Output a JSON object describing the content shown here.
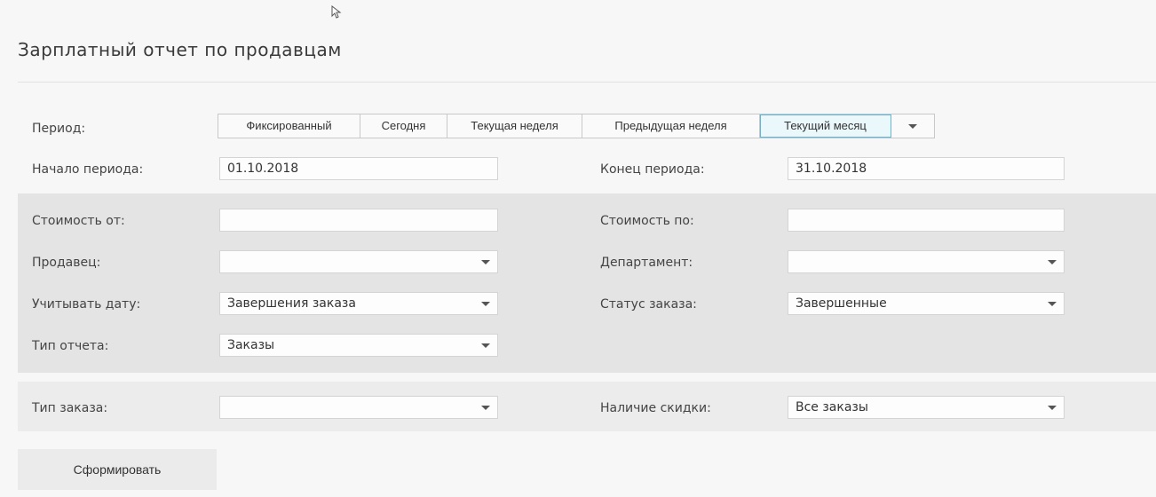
{
  "page": {
    "title": "Зарплатный отчет по продавцам"
  },
  "period": {
    "label": "Период:",
    "buttons": [
      "Фиксированный",
      "Сегодня",
      "Текущая неделя",
      "Предыдущая неделя",
      "Текущий месяц"
    ],
    "active": "Текущий месяц"
  },
  "fields": {
    "start_label": "Начало периода:",
    "start_value": "01.10.2018",
    "end_label": "Конец периода:",
    "end_value": "31.10.2018",
    "cost_from_label": "Стоимость от:",
    "cost_from_value": "",
    "cost_to_label": "Стоимость по:",
    "cost_to_value": "",
    "seller_label": "Продавец:",
    "seller_value": "",
    "department_label": "Департамент:",
    "department_value": "",
    "date_basis_label": "Учитывать дату:",
    "date_basis_value": "Завершения заказа",
    "status_label": "Статус заказа:",
    "status_value": "Завершенные",
    "report_type_label": "Тип отчета:",
    "report_type_value": "Заказы",
    "order_type_label": "Тип заказа:",
    "order_type_value": "",
    "discount_label": "Наличие скидки:",
    "discount_value": "Все заказы"
  },
  "actions": {
    "submit_label": "Сформировать"
  },
  "icons": {
    "cursor": "mouse-pointer-icon",
    "dropdown": "caret-down-icon"
  },
  "colors": {
    "active_border": "#5fb8d9",
    "active_bg": "#eaf7fb",
    "band": "#e4e4e4"
  }
}
